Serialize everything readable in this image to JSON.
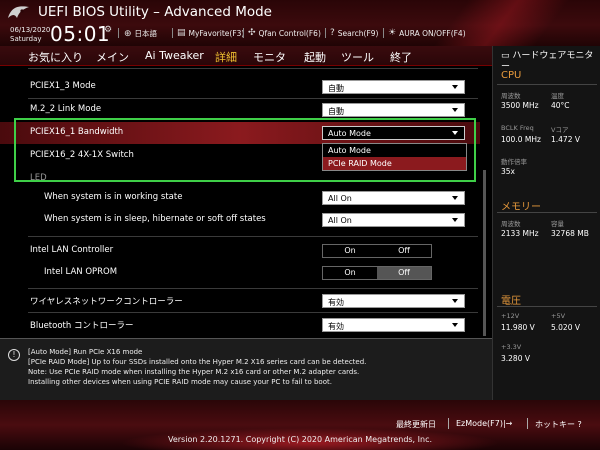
{
  "header": {
    "title": "UEFI BIOS Utility – Advanced Mode",
    "date": "06/13/2020",
    "day": "Saturday",
    "time": "05:01",
    "buttons": {
      "language": "日本語",
      "myfavorite": "MyFavorite(F3)",
      "qfan": "Qfan Control(F6)",
      "search": "Search(F9)",
      "aura": "AURA ON/OFF(F4)"
    }
  },
  "menu": {
    "items": [
      "お気に入り",
      "メイン",
      "Ai Tweaker",
      "詳細",
      "モニタ",
      "起動",
      "ツール",
      "終了"
    ],
    "active": "詳細"
  },
  "settings": {
    "pciex1_3": {
      "label": "PCIEX1_3 Mode",
      "value": "自動"
    },
    "m2_2": {
      "label": "M.2_2 Link Mode",
      "value": "自動"
    },
    "pciex16_1": {
      "label": "PCIEX16_1 Bandwidth",
      "value": "Auto Mode"
    },
    "pciex16_2": {
      "label": "PCIEX16_2 4X-1X Switch"
    },
    "dropdown_options": [
      "Auto Mode",
      "PCIe RAID Mode"
    ],
    "led_section": "LED",
    "led_working": {
      "label": "When system is in working state",
      "value": "All On"
    },
    "led_sleep": {
      "label": "When system is in sleep, hibernate or soft off states",
      "value": "All On"
    },
    "lan": {
      "label": "Intel LAN Controller",
      "on": "On",
      "off": "Off",
      "selected": "On"
    },
    "lan_oprom": {
      "label": "Intel LAN OPROM",
      "on": "On",
      "off": "Off",
      "selected": "Off"
    },
    "wireless": {
      "label": "ワイヤレスネットワークコントローラー",
      "value": "有効"
    },
    "bluetooth": {
      "label": "Bluetooth コントローラー",
      "value": "有効"
    }
  },
  "info": {
    "icon": "info-icon",
    "lines": [
      "[Auto Mode] Run PCIe X16 mode",
      "[PCIe RAID Mode] Up to four SSDs installed onto the Hyper M.2 X16 series card can be detected.",
      "Note: Use PCIe RAID mode when installing the Hyper M.2 x16 card or other M.2 adapter cards.",
      "Installing other devices when using PCIE RAID mode may cause your PC to fail to boot."
    ]
  },
  "hw_monitor": {
    "title": "ハードウェアモニター",
    "cpu": {
      "heading": "CPU",
      "freq_label": "周波数",
      "freq_value": "3500 MHz",
      "temp_label": "温度",
      "temp_value": "40°C",
      "bclk_label": "BCLK Freq",
      "bclk_value": "100.0 MHz",
      "vcore_label": "Vコア",
      "vcore_value": "1.472 V",
      "ratio_label": "動作倍率",
      "ratio_value": "35x"
    },
    "memory": {
      "heading": "メモリー",
      "freq_label": "周波数",
      "freq_value": "2133 MHz",
      "cap_label": "容量",
      "cap_value": "32768 MB"
    },
    "voltage": {
      "heading": "電圧",
      "v12_label": "+12V",
      "v12_value": "11.980 V",
      "v5_label": "+5V",
      "v5_value": "5.020 V",
      "v33_label": "+3.3V",
      "v33_value": "3.280 V"
    }
  },
  "footer": {
    "last_modified": "最終更新日",
    "ezmode": "EzMode(F7)|→",
    "hotkey": "ホットキー ?",
    "version": "Version 2.20.1271. Copyright (C) 2020 American Megatrends, Inc."
  },
  "colors": {
    "accent_gold": "#f0c030",
    "highlight_red": "#8b1a1e",
    "hw_section_orange": "#e89a3c",
    "annotation_green": "#3fcf48"
  }
}
